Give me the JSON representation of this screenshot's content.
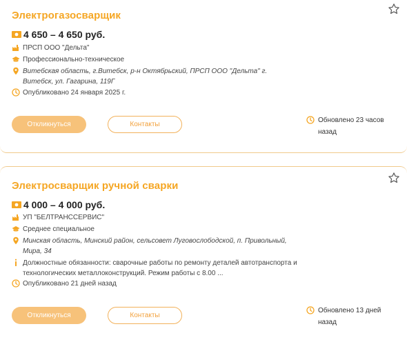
{
  "colors": {
    "accent": "#f5a623",
    "button_fill": "#f7c27a",
    "border": "#f0c98a"
  },
  "vacancies": [
    {
      "title": "Электрогазосварщик",
      "salary": "4 650 – 4 650 руб.",
      "company": "ПРСП ООО \"Дельта\"",
      "education": "Профессионально-техническое",
      "address": "Витебская область, г.Витебск, р-н Октябрьский, ПРСП ООО \"Дельта\" г. Витебск, ул. Гагарина, 119Г",
      "published": "Опубликовано 24 января 2025 г.",
      "respond_label": "Откликнуться",
      "contacts_label": "Контакты",
      "updated": "Обновлено 23 часов назад"
    },
    {
      "title": "Электросварщик ручной сварки",
      "salary": "4 000 – 4 000 руб.",
      "company": "УП \"БЕЛТРАНССЕРВИС\"",
      "education": "Среднее специальное",
      "address": "Минская область, Минский район, сельсовет Луговослободской, п. Привольный, Мира, 34",
      "duties": "Должностные обязанности: сварочные работы по ремонту деталей автотранспорта и технологических металлоконструкций. Режим работы с 8.00 ...",
      "published": "Опубликовано 21 дней назад",
      "respond_label": "Откликнуться",
      "contacts_label": "Контакты",
      "updated": "Обновлено 13 дней назад"
    }
  ]
}
